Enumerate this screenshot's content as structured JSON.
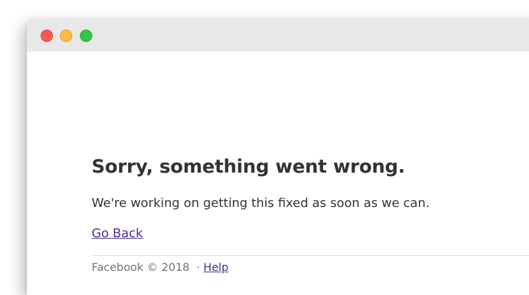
{
  "window": {
    "controls": [
      "close",
      "minimize",
      "zoom"
    ],
    "colors": {
      "close": "#fc5753",
      "minimize": "#fdbc40",
      "zoom": "#33c748",
      "titlebar": "#e8e8e8"
    }
  },
  "error": {
    "title": "Sorry, something went wrong.",
    "message": "We're working on getting this fixed as soon as we can.",
    "back_link": "Go Back"
  },
  "footer": {
    "brand": "Facebook",
    "copyright": "©",
    "year": "2018",
    "separator": "·",
    "help_link": "Help"
  },
  "colors": {
    "text": "#333333",
    "link": "#4b2f8a",
    "footer_text": "#737373",
    "divider": "#dddddd"
  }
}
